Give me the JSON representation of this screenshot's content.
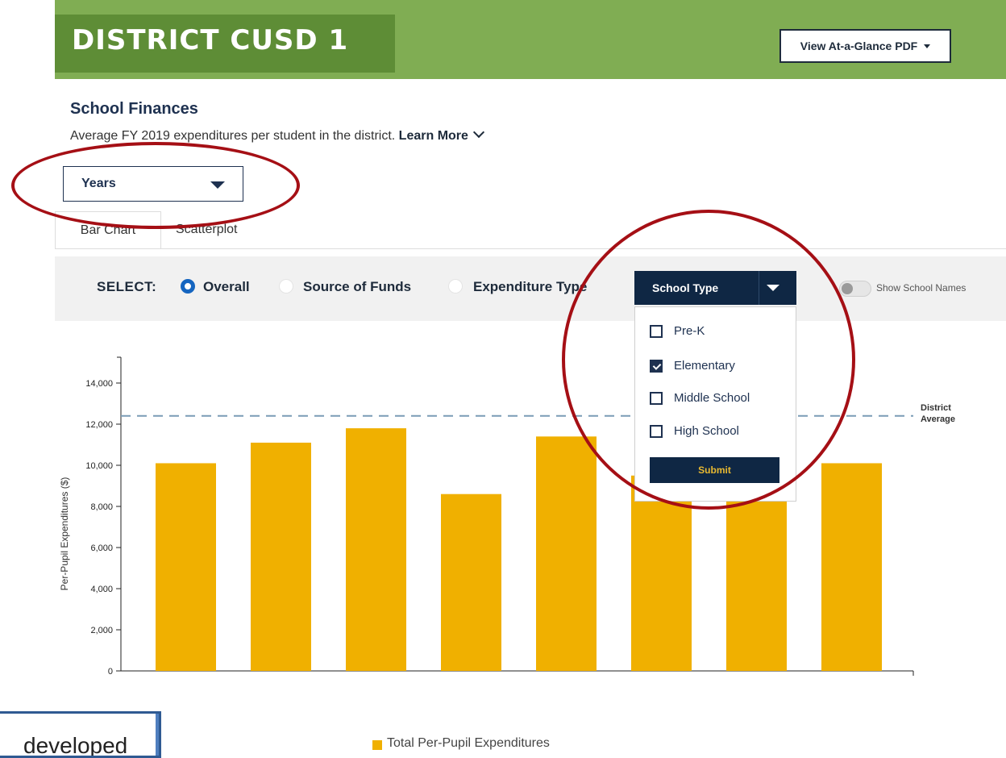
{
  "header": {
    "title": "DISTRICT CUSD 1",
    "pdf_button": "View At-a-Glance PDF"
  },
  "section": {
    "title": "School Finances",
    "subtitle": "Average FY 2019 expenditures per student in the district.",
    "learn_more": "Learn More"
  },
  "years_select": {
    "value": "Years"
  },
  "tabs": [
    {
      "label": "Bar Chart",
      "active": true
    },
    {
      "label": "Scatterplot",
      "active": false
    }
  ],
  "select_bar": {
    "label": "SELECT:",
    "options": [
      {
        "label": "Overall",
        "selected": true
      },
      {
        "label": "Source of Funds",
        "selected": false
      },
      {
        "label": "Expenditure Type",
        "selected": false
      }
    ],
    "toggle_label": "Show School Names"
  },
  "school_type": {
    "button_label": "School Type",
    "options": [
      {
        "label": "Pre-K",
        "checked": false
      },
      {
        "label": "Elementary",
        "checked": true
      },
      {
        "label": "Middle School",
        "checked": false
      },
      {
        "label": "High School",
        "checked": false
      }
    ],
    "submit_label": "Submit"
  },
  "chart_data": {
    "type": "bar",
    "ylabel": "Per-Pupil Expenditures ($)",
    "ylim": [
      0,
      15000
    ],
    "yticks": [
      "0",
      "2,000",
      "4,000",
      "6,000",
      "8,000",
      "10,000",
      "12,000",
      "14,000"
    ],
    "series": [
      {
        "name": "Total Per-Pupil Expenditures",
        "values": [
          10100,
          11100,
          11800,
          8600,
          11400,
          9500,
          9500,
          10100
        ]
      }
    ],
    "reference_line": {
      "label_line1": "District",
      "label_line2": "Average",
      "value": 12400
    },
    "colors": {
      "bar": "#f0b000",
      "reference": "#7a9cb5"
    }
  },
  "note": {
    "text": "developed"
  },
  "colors": {
    "header_green": "#80ad53",
    "title_green": "#5e8d36",
    "navy": "#0f2744",
    "annotation_red": "#a50f15"
  }
}
